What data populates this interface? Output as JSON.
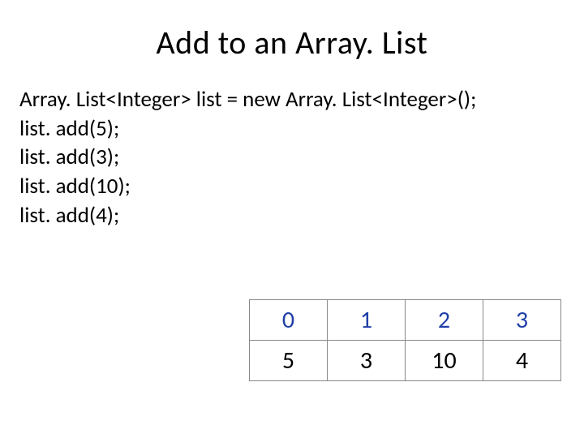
{
  "title": "Add to an Array. List",
  "code": {
    "line1": "Array. List<Integer> list = new Array. List<Integer>();",
    "line2": "list. add(5);",
    "line3": "list. add(3);",
    "line4": "list. add(10);",
    "line5": "list. add(4);"
  },
  "chart_data": {
    "type": "table",
    "title": "",
    "columns": [
      "0",
      "1",
      "2",
      "3"
    ],
    "rows": [
      [
        "5",
        "3",
        "10",
        "4"
      ]
    ],
    "index_row": [
      "0",
      "1",
      "2",
      "3"
    ],
    "value_row": [
      "5",
      "3",
      "10",
      "4"
    ]
  }
}
